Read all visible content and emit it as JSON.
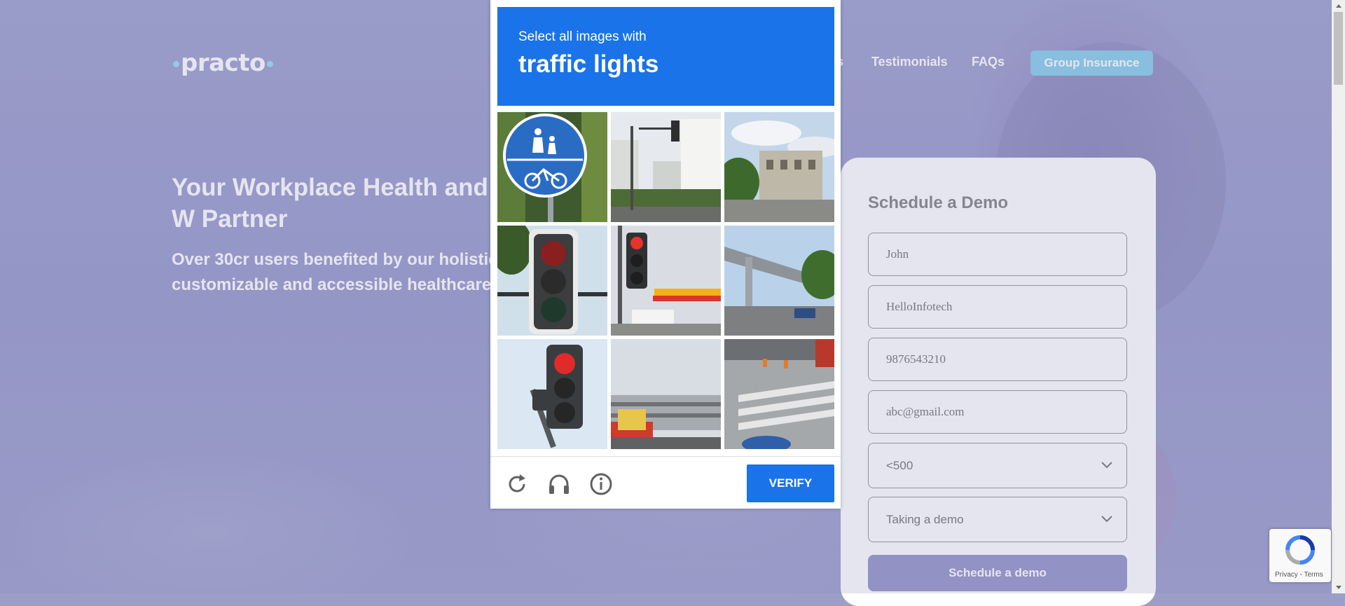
{
  "header": {
    "logo_text": "practo",
    "nav_partial": "s",
    "nav_testimonials": "Testimonials",
    "nav_faqs": "FAQs",
    "group_insurance": "Group Insurance"
  },
  "hero": {
    "title": "Your Workplace Health and W Partner",
    "subtitle": "Over 30cr users benefited by our holistic, customizable and accessible healthcare s"
  },
  "form": {
    "title": "Schedule a Demo",
    "name_value": "John",
    "company_value": "HelloInfotech",
    "phone_value": "9876543210",
    "email_value": "abc@gmail.com",
    "size_value": "<500",
    "reason_value": "Taking a demo",
    "submit_label": "Schedule a demo"
  },
  "captcha": {
    "prompt": "Select all images with",
    "target": "traffic lights",
    "verify_label": "VERIFY",
    "tiles": [
      "bike-pedestrian-sign",
      "street-with-traffic-light",
      "building-street",
      "traffic-light-closeup",
      "traffic-light-gas-station",
      "overpass-street",
      "traffic-light-sky",
      "parking-garage",
      "crosswalk"
    ]
  },
  "recaptcha_badge": {
    "terms": "Privacy - Terms"
  },
  "colors": {
    "captcha_blue": "#1a73e8",
    "group_insurance_btn": "#8ed0ea",
    "submit_btn": "#9a9acb"
  }
}
